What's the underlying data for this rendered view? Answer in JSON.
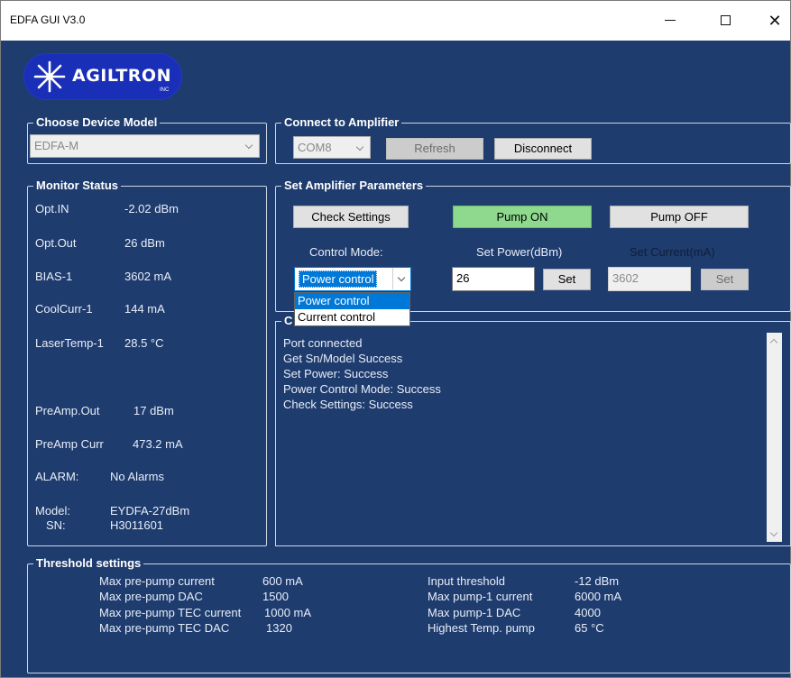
{
  "window": {
    "title": "EDFA GUI V3.0",
    "minimize": "—",
    "close": "✕"
  },
  "logo": {
    "text": "AGILTRON",
    "inc": "INC"
  },
  "device": {
    "group_title": "Choose Device Model",
    "model_selected": "EDFA-M"
  },
  "connect": {
    "group_title": "Connect to Amplifier",
    "port_selected": "COM8",
    "refresh_label": "Refresh",
    "disconnect_label": "Disconnect"
  },
  "monitor": {
    "group_title": "Monitor Status",
    "items": [
      {
        "label": "Opt.IN",
        "value": "-2.02 dBm"
      },
      {
        "label": "Opt.Out",
        "value": "26 dBm"
      },
      {
        "label": "BIAS-1",
        "value": "3602 mA"
      },
      {
        "label": "CoolCurr-1",
        "value": "144 mA"
      },
      {
        "label": "LaserTemp-1",
        "value": "28.5 °C"
      },
      {
        "label": "PreAmp.Out",
        "value": "17 dBm"
      },
      {
        "label": "PreAmp Curr",
        "value": "473.2 mA"
      },
      {
        "label": "ALARM:",
        "value": "No Alarms"
      }
    ],
    "model_label": "Model:",
    "model_value": "EYDFA-27dBm",
    "sn_label": "SN:",
    "sn_value": "H3011601"
  },
  "params": {
    "group_title": "Set Amplifier Parameters",
    "check_settings_label": "Check Settings",
    "pump_on_label": "Pump ON",
    "pump_off_label": "Pump OFF",
    "control_mode_label": "Control Mode:",
    "control_mode_selected": "Power control",
    "control_mode_options": [
      "Power control",
      "Current control"
    ],
    "set_power_label": "Set Power(dBm)",
    "set_power_value": "26",
    "set_power_button": "Set",
    "set_current_label": "Set Current(mA)",
    "set_current_value": "3602",
    "set_current_button": "Set"
  },
  "log": {
    "group_title": "C",
    "lines": [
      "Port connected",
      "Get Sn/Model Success",
      "Set Power: Success",
      "Power Control Mode: Success",
      "Check Settings: Success"
    ]
  },
  "threshold": {
    "group_title": "Threshold settings",
    "left": [
      {
        "label": "Max pre-pump current",
        "value": "600 mA"
      },
      {
        "label": "Max pre-pump DAC",
        "value": "1500"
      },
      {
        "label": "Max pre-pump TEC current",
        "value": "1000 mA"
      },
      {
        "label": "Max pre-pump TEC DAC",
        "value": "1320"
      }
    ],
    "right": [
      {
        "label": "Input threshold",
        "value": "-12 dBm"
      },
      {
        "label": "Max pump-1 current",
        "value": "6000 mA"
      },
      {
        "label": "Max pump-1 DAC",
        "value": "4000"
      },
      {
        "label": "Highest Temp. pump",
        "value": "65 °C"
      }
    ]
  },
  "colors": {
    "background": "#1f3c6e",
    "pump_on": "#8ed98e",
    "selection": "#0078d7",
    "logo": "#1a2fb8"
  }
}
